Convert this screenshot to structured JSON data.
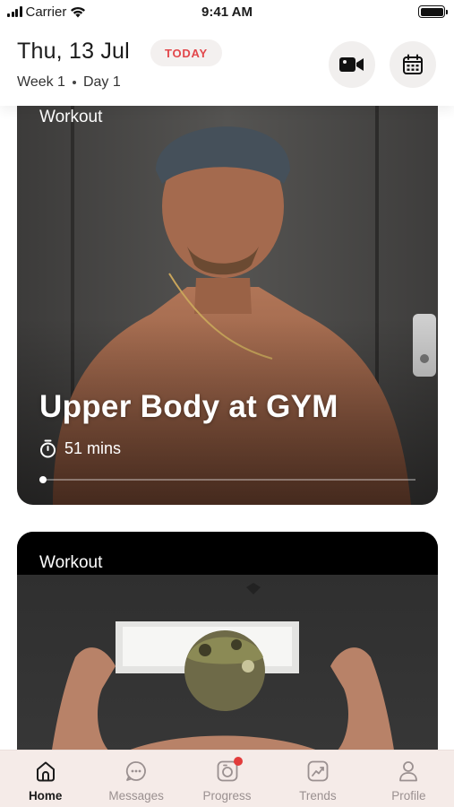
{
  "status_bar": {
    "carrier": "Carrier",
    "time": "9:41 AM"
  },
  "header": {
    "date": "Thu, 13 Jul",
    "today_badge": "TODAY",
    "week": "Week 1",
    "day": "Day 1",
    "video_icon": "video-camera-icon",
    "calendar_icon": "calendar-icon"
  },
  "cards": [
    {
      "label": "Workout",
      "title": "Upper Body at GYM",
      "duration": "51 mins",
      "progress": 0.0
    },
    {
      "label": "Workout"
    }
  ],
  "tabbar": {
    "items": [
      {
        "label": "Home",
        "icon": "home-icon",
        "active": true
      },
      {
        "label": "Messages",
        "icon": "chat-icon",
        "active": false
      },
      {
        "label": "Progress",
        "icon": "camera-icon",
        "active": false,
        "notification": true
      },
      {
        "label": "Trends",
        "icon": "trend-chart-icon",
        "active": false
      },
      {
        "label": "Profile",
        "icon": "user-icon",
        "active": false
      }
    ]
  },
  "colors": {
    "accent_red": "#e2474b",
    "tabbar_bg": "#f5ebe8",
    "badge_bg": "#f3f0ef",
    "inactive_tab": "#9a9090"
  }
}
